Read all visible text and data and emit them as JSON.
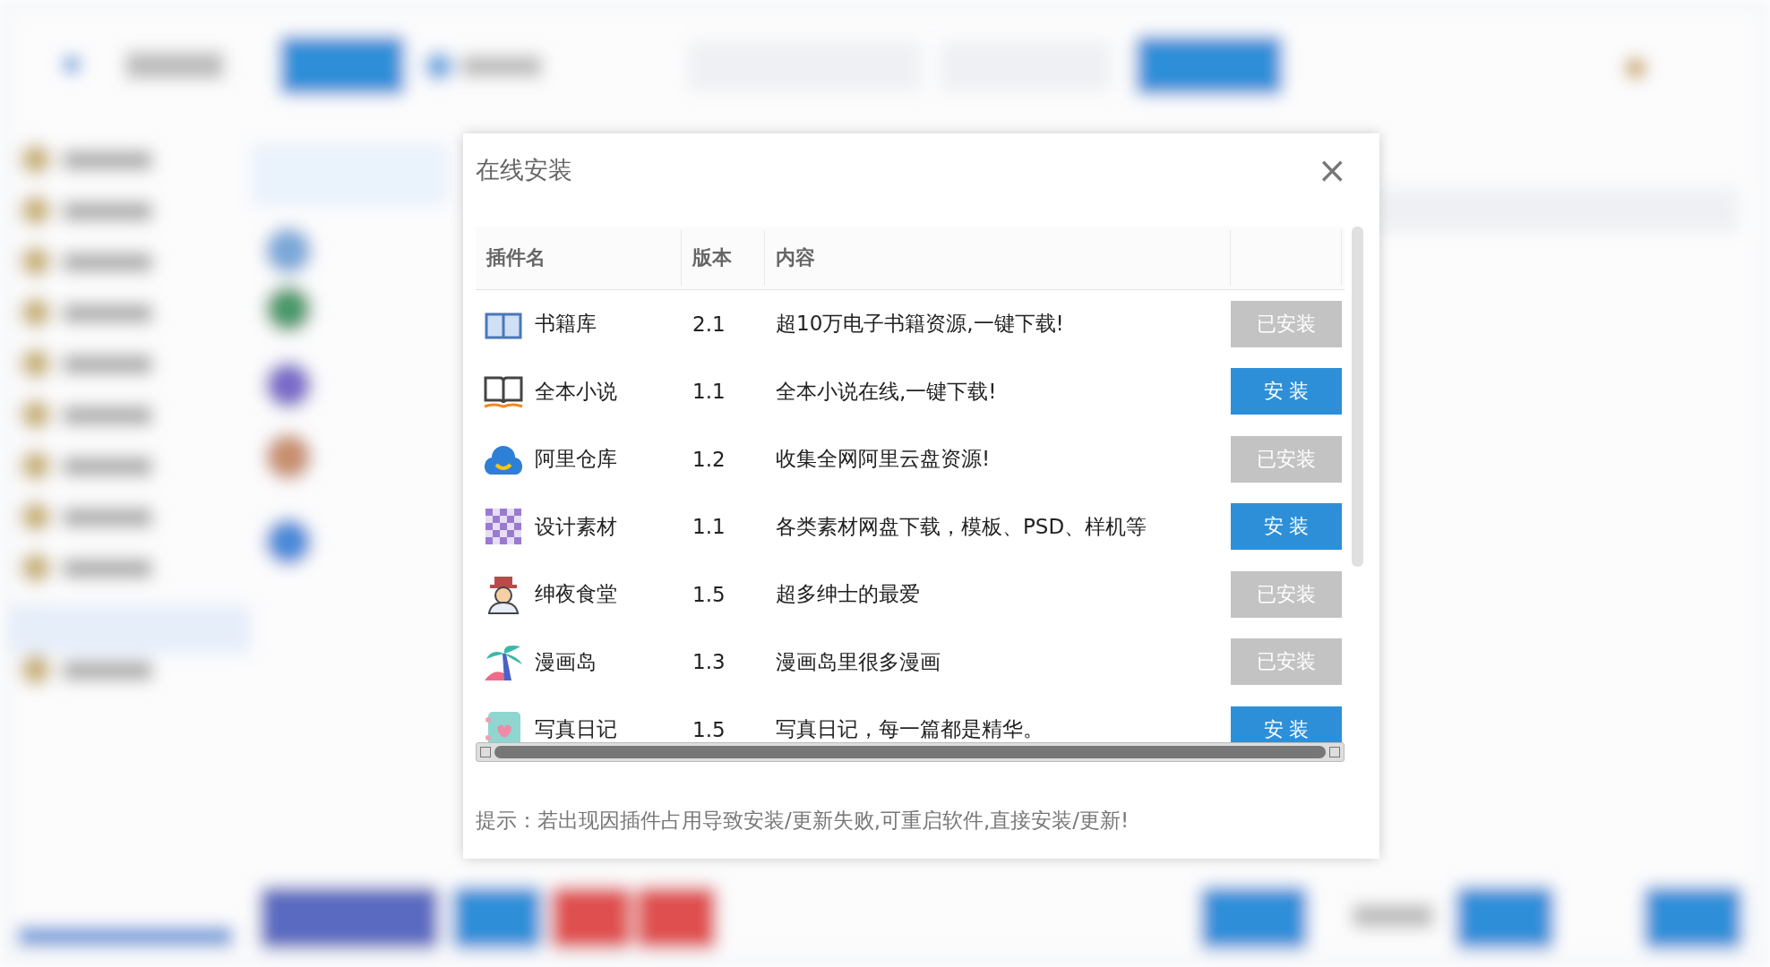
{
  "dialog": {
    "title": "在线安装",
    "close": "×",
    "table": {
      "columns": [
        "插件名",
        "版本",
        "内容",
        ""
      ],
      "rows": [
        {
          "name": "书籍库",
          "version": "2.1",
          "content": "超10万电子书籍资源,一键下载!",
          "installed": true,
          "action": "已安装"
        },
        {
          "name": "全本小说",
          "version": "1.1",
          "content": "全本小说在线,一键下载!",
          "installed": false,
          "action": "安 装"
        },
        {
          "name": "阿里仓库",
          "version": "1.2",
          "content": "收集全网阿里云盘资源!",
          "installed": true,
          "action": "已安装"
        },
        {
          "name": "设计素材",
          "version": "1.1",
          "content": "各类素材网盘下载，模板、PSD、样机等",
          "installed": false,
          "action": "安 装"
        },
        {
          "name": "绅夜食堂",
          "version": "1.5",
          "content": "超多绅士的最爱",
          "installed": true,
          "action": "已安装"
        },
        {
          "name": "漫画岛",
          "version": "1.3",
          "content": "漫画岛里很多漫画",
          "installed": true,
          "action": "已安装"
        },
        {
          "name": "写真日记",
          "version": "1.5",
          "content": "写真日记，每一篇都是精华。",
          "installed": false,
          "action": "安 装"
        }
      ]
    },
    "tip": "提示：若出现因插件占用导致安装/更新失败,可重启软件,直接安装/更新!"
  }
}
